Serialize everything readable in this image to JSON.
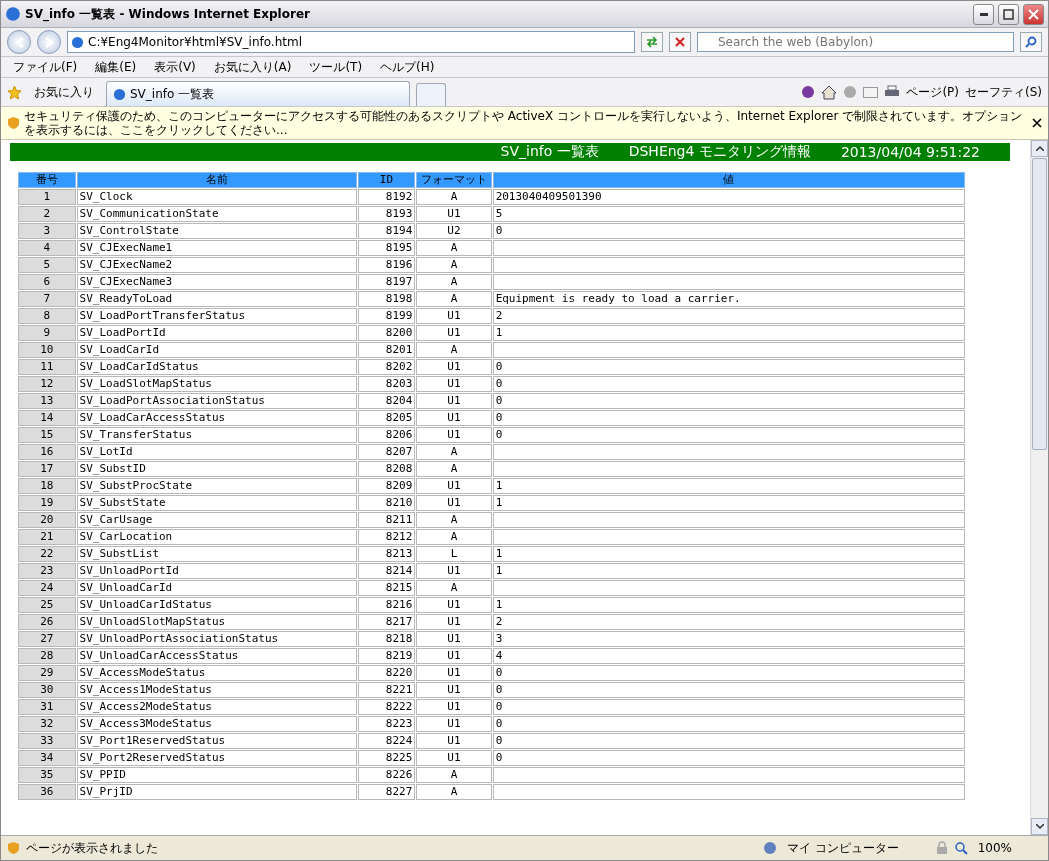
{
  "window": {
    "title": "SV_info 一覧表 - Windows Internet Explorer"
  },
  "address_bar": {
    "url": "C:¥Eng4Monitor¥html¥SV_info.html"
  },
  "search": {
    "placeholder": "Search the web (Babylon)"
  },
  "menu": [
    "ファイル(F)",
    "編集(E)",
    "表示(V)",
    "お気に入り(A)",
    "ツール(T)",
    "ヘルプ(H)"
  ],
  "favorites": {
    "label": "お気に入り"
  },
  "tabs": [
    {
      "label": "SV_info 一覧表",
      "selected": true
    }
  ],
  "command_bar": [
    "ページ(P)",
    "セーフティ(S)"
  ],
  "info_bar": {
    "text": "セキュリティ保護のため、このコンピューターにアクセスする可能性のあるスクリプトや ActiveX コントロールを実行しないよう、Internet Explorer で制限されています。オプションを表示するには、ここをクリックしてください..."
  },
  "banner": {
    "title": "SV_info 一覧表",
    "subtitle": "DSHEng4 モニタリング情報",
    "timestamp": "2013/04/04 9:51:22"
  },
  "table": {
    "columns": [
      "番号",
      "名前",
      "ID",
      "フォーマット",
      "値"
    ],
    "rows": [
      {
        "no": "1",
        "name": "SV_Clock",
        "id": "8192",
        "format": "A",
        "value": "2013040409501390"
      },
      {
        "no": "2",
        "name": "SV_CommunicationState",
        "id": "8193",
        "format": "U1",
        "value": "5"
      },
      {
        "no": "3",
        "name": "SV_ControlState",
        "id": "8194",
        "format": "U2",
        "value": "0"
      },
      {
        "no": "4",
        "name": "SV_CJExecName1",
        "id": "8195",
        "format": "A"
      },
      {
        "no": "5",
        "name": "SV_CJExecName2",
        "id": "8196",
        "format": "A"
      },
      {
        "no": "6",
        "name": "SV_CJExecName3",
        "id": "8197",
        "format": "A"
      },
      {
        "no": "7",
        "name": "SV_ReadyToLoad",
        "id": "8198",
        "format": "A",
        "value": "Equipment is ready to load a carrier."
      },
      {
        "no": "8",
        "name": "SV_LoadPortTransferStatus",
        "id": "8199",
        "format": "U1",
        "value": "2"
      },
      {
        "no": "9",
        "name": "SV_LoadPortId",
        "id": "8200",
        "format": "U1",
        "value": "1"
      },
      {
        "no": "10",
        "name": "SV_LoadCarId",
        "id": "8201",
        "format": "A"
      },
      {
        "no": "11",
        "name": "SV_LoadCarIdStatus",
        "id": "8202",
        "format": "U1",
        "value": "0"
      },
      {
        "no": "12",
        "name": "SV_LoadSlotMapStatus",
        "id": "8203",
        "format": "U1",
        "value": "0"
      },
      {
        "no": "13",
        "name": "SV_LoadPortAssociationStatus",
        "id": "8204",
        "format": "U1",
        "value": "0"
      },
      {
        "no": "14",
        "name": "SV_LoadCarAccessStatus",
        "id": "8205",
        "format": "U1",
        "value": "0"
      },
      {
        "no": "15",
        "name": "SV_TransferStatus",
        "id": "8206",
        "format": "U1",
        "value": "0"
      },
      {
        "no": "16",
        "name": "SV_LotId",
        "id": "8207",
        "format": "A"
      },
      {
        "no": "17",
        "name": "SV_SubstID",
        "id": "8208",
        "format": "A"
      },
      {
        "no": "18",
        "name": "SV_SubstProcState",
        "id": "8209",
        "format": "U1",
        "value": "1"
      },
      {
        "no": "19",
        "name": "SV_SubstState",
        "id": "8210",
        "format": "U1",
        "value": "1"
      },
      {
        "no": "20",
        "name": "SV_CarUsage",
        "id": "8211",
        "format": "A"
      },
      {
        "no": "21",
        "name": "SV_CarLocation",
        "id": "8212",
        "format": "A"
      },
      {
        "no": "22",
        "name": "SV_SubstList",
        "id": "8213",
        "format": "L",
        "value": "1"
      },
      {
        "no": "23",
        "name": "SV_UnloadPortId",
        "id": "8214",
        "format": "U1",
        "value": "1"
      },
      {
        "no": "24",
        "name": "SV_UnloadCarId",
        "id": "8215",
        "format": "A"
      },
      {
        "no": "25",
        "name": "SV_UnloadCarIdStatus",
        "id": "8216",
        "format": "U1",
        "value": "1"
      },
      {
        "no": "26",
        "name": "SV_UnloadSlotMapStatus",
        "id": "8217",
        "format": "U1",
        "value": "2"
      },
      {
        "no": "27",
        "name": "SV_UnloadPortAssociationStatus",
        "id": "8218",
        "format": "U1",
        "value": "3"
      },
      {
        "no": "28",
        "name": "SV_UnloadCarAccessStatus",
        "id": "8219",
        "format": "U1",
        "value": "4"
      },
      {
        "no": "29",
        "name": "SV_AccessModeStatus",
        "id": "8220",
        "format": "U1",
        "value": "0"
      },
      {
        "no": "30",
        "name": "SV_Access1ModeStatus",
        "id": "8221",
        "format": "U1",
        "value": "0"
      },
      {
        "no": "31",
        "name": "SV_Access2ModeStatus",
        "id": "8222",
        "format": "U1",
        "value": "0"
      },
      {
        "no": "32",
        "name": "SV_Access3ModeStatus",
        "id": "8223",
        "format": "U1",
        "value": "0"
      },
      {
        "no": "33",
        "name": "SV_Port1ReservedStatus",
        "id": "8224",
        "format": "U1",
        "value": "0"
      },
      {
        "no": "34",
        "name": "SV_Port2ReservedStatus",
        "id": "8225",
        "format": "U1",
        "value": "0"
      },
      {
        "no": "35",
        "name": "SV_PPID",
        "id": "8226",
        "format": "A"
      },
      {
        "no": "36",
        "name": "SV_PrjID",
        "id": "8227",
        "format": "A"
      }
    ]
  },
  "status_bar": {
    "text": "ページが表示されました",
    "zone": "マイ コンピューター",
    "zoom": "100%"
  }
}
